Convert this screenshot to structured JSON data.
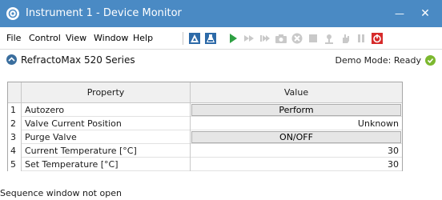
{
  "window": {
    "title": "Instrument 1 - Device Monitor",
    "min_glyph": "—",
    "close_glyph": "✕",
    "titlebar_color": "#4a8ac4"
  },
  "menu": {
    "items": [
      "File",
      "Control",
      "View",
      "Window",
      "Help"
    ]
  },
  "toolbar": {
    "icons": [
      {
        "name": "method-icon",
        "enabled": true,
        "color": "#2d6aa8"
      },
      {
        "name": "flask-icon",
        "enabled": true,
        "color": "#2d6aa8"
      },
      {
        "name": "run-icon",
        "enabled": true,
        "color": "#2ea043"
      },
      {
        "name": "fast-forward-icon",
        "enabled": false
      },
      {
        "name": "skip-icon",
        "enabled": false
      },
      {
        "name": "camera-icon",
        "enabled": false
      },
      {
        "name": "abort-icon",
        "enabled": false
      },
      {
        "name": "stop-icon",
        "enabled": false
      },
      {
        "name": "valve-icon",
        "enabled": false
      },
      {
        "name": "hand-icon",
        "enabled": false
      },
      {
        "name": "pause-icon",
        "enabled": false
      },
      {
        "name": "power-icon",
        "enabled": true,
        "color": "#d62b2b"
      }
    ]
  },
  "device": {
    "name": "RefractoMax 520 Series",
    "status": "Demo Mode: Ready",
    "status_color": "#7cb82f"
  },
  "grid": {
    "headers": {
      "property": "Property",
      "value": "Value"
    },
    "rows": [
      {
        "num": "1",
        "property": "Autozero",
        "value": "Perform",
        "kind": "button"
      },
      {
        "num": "2",
        "property": "Valve Current Position",
        "value": "Unknown",
        "kind": "text"
      },
      {
        "num": "3",
        "property": "Purge Valve",
        "value": "ON/OFF",
        "kind": "button"
      },
      {
        "num": "4",
        "property": "Current Temperature [°C]",
        "value": "30",
        "kind": "text"
      },
      {
        "num": "5",
        "property": "Set Temperature [°C]",
        "value": "30",
        "kind": "text"
      }
    ]
  },
  "statusbar": {
    "text": "Sequence window not open"
  }
}
